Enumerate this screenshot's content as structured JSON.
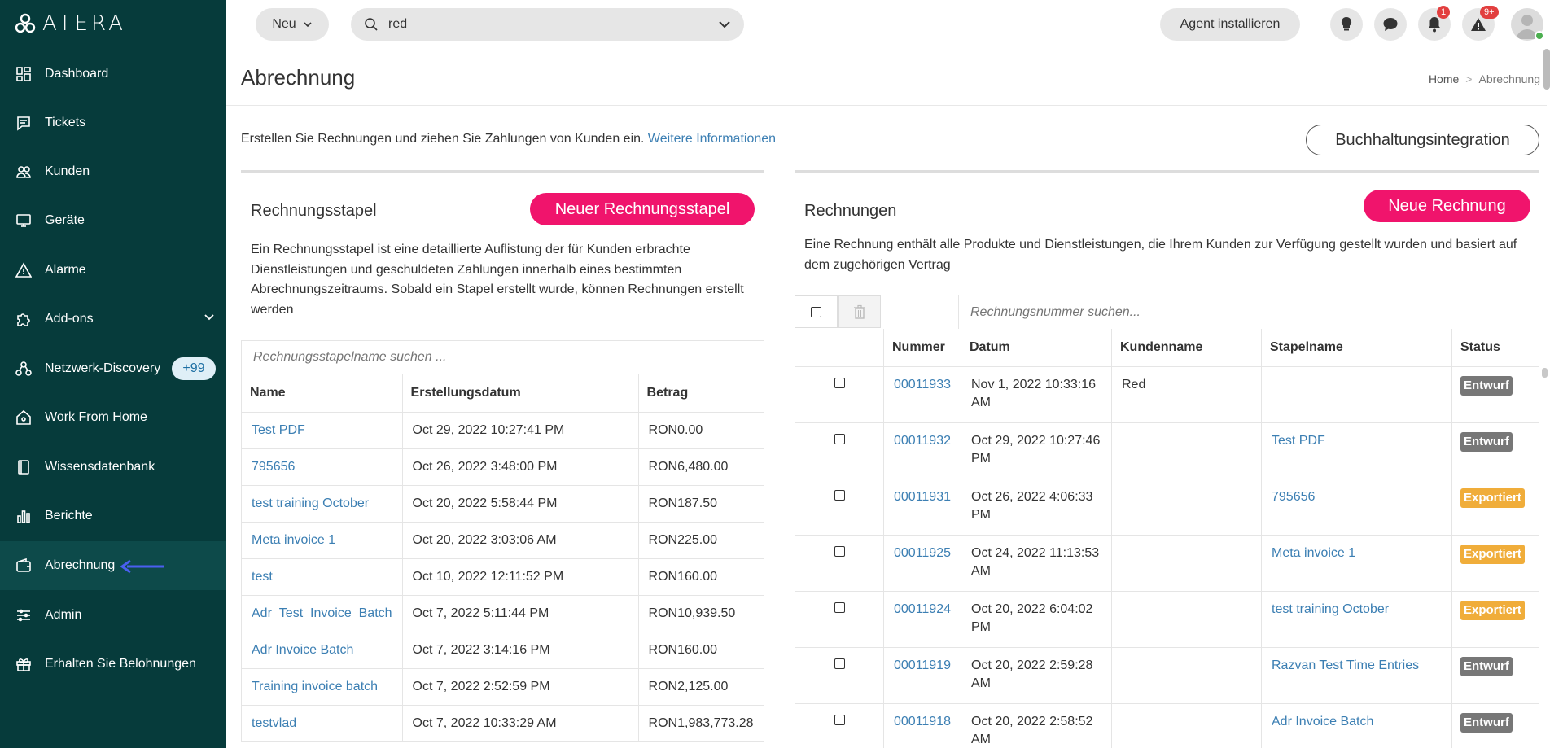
{
  "app": {
    "logo_text": "ATERA"
  },
  "sidebar": {
    "items": [
      {
        "label": "Dashboard",
        "icon": "dashboard-icon"
      },
      {
        "label": "Tickets",
        "icon": "tickets-icon"
      },
      {
        "label": "Kunden",
        "icon": "users-icon"
      },
      {
        "label": "Geräte",
        "icon": "monitor-icon"
      },
      {
        "label": "Alarme",
        "icon": "warning-icon"
      },
      {
        "label": "Add-ons",
        "icon": "puzzle-icon"
      },
      {
        "label": "Netzwerk-Discovery",
        "icon": "network-icon",
        "badge": "+99"
      },
      {
        "label": "Work From Home",
        "icon": "home-icon"
      },
      {
        "label": "Wissensdatenbank",
        "icon": "book-icon"
      },
      {
        "label": "Berichte",
        "icon": "chart-icon"
      },
      {
        "label": "Abrechnung",
        "icon": "wallet-icon"
      },
      {
        "label": "Admin",
        "icon": "sliders-icon"
      },
      {
        "label": "Erhalten Sie Belohnungen",
        "icon": "gift-icon"
      }
    ]
  },
  "topbar": {
    "new_label": "Neu",
    "search_value": "red",
    "agent_label": "Agent installieren",
    "notif_count": "1",
    "alert_count": "9+"
  },
  "header": {
    "title": "Abrechnung",
    "breadcrumb_home": "Home",
    "breadcrumb_sep": ">",
    "breadcrumb_current": "Abrechnung"
  },
  "intro": {
    "text": "Erstellen Sie Rechnungen und ziehen Sie Zahlungen von Kunden ein.",
    "link": "Weitere Informationen",
    "accounting_button": "Buchhaltungsintegration"
  },
  "batches": {
    "title": "Rechnungsstapel",
    "new_button": "Neuer Rechnungsstapel",
    "description": "Ein Rechnungsstapel ist eine detaillierte Auflistung der für Kunden erbrachte Dienstleistungen und geschuldeten Zahlungen innerhalb eines bestimmten Abrechnungszeitraums. Sobald ein Stapel erstellt wurde, können Rechnungen erstellt werden",
    "search_placeholder": "Rechnungsstapelname suchen ...",
    "columns": [
      "Name",
      "Erstellungsdatum",
      "Betrag"
    ],
    "rows": [
      {
        "name": "Test PDF",
        "date": "Oct 29, 2022 10:27:41 PM",
        "amount": "RON0.00"
      },
      {
        "name": "795656",
        "date": "Oct 26, 2022 3:48:00 PM",
        "amount": "RON6,480.00"
      },
      {
        "name": "test training October",
        "date": "Oct 20, 2022 5:58:44 PM",
        "amount": "RON187.50"
      },
      {
        "name": "Meta invoice 1",
        "date": "Oct 20, 2022 3:03:06 AM",
        "amount": "RON225.00"
      },
      {
        "name": "test",
        "date": "Oct 10, 2022 12:11:52 PM",
        "amount": "RON160.00"
      },
      {
        "name": "Adr_Test_Invoice_Batch",
        "date": "Oct 7, 2022 5:11:44 PM",
        "amount": "RON10,939.50"
      },
      {
        "name": "Adr Invoice Batch",
        "date": "Oct 7, 2022 3:14:16 PM",
        "amount": "RON160.00"
      },
      {
        "name": "Training invoice batch",
        "date": "Oct 7, 2022 2:52:59 PM",
        "amount": "RON2,125.00"
      },
      {
        "name": "testvlad",
        "date": "Oct 7, 2022 10:33:29 AM",
        "amount": "RON1,983,773.28"
      }
    ]
  },
  "invoices": {
    "title": "Rechnungen",
    "new_button": "Neue Rechnung",
    "description": "Eine Rechnung enthält alle Produkte und Dienstleistungen, die Ihrem Kunden zur Verfügung gestellt wurden und basiert auf dem zugehörigen Vertrag",
    "search_placeholder": "Rechnungsnummer suchen...",
    "columns": [
      "Nummer",
      "Datum",
      "Kundenname",
      "Stapelname",
      "Status"
    ],
    "rows": [
      {
        "number": "00011933",
        "date": "Nov 1, 2022 10:33:16 AM",
        "customer": "Red",
        "batch": "",
        "status": "Entwurf"
      },
      {
        "number": "00011932",
        "date": "Oct 29, 2022 10:27:46 PM",
        "customer": "",
        "batch": "Test PDF",
        "status": "Entwurf"
      },
      {
        "number": "00011931",
        "date": "Oct 26, 2022 4:06:33 PM",
        "customer": "",
        "batch": "795656",
        "status": "Exportiert"
      },
      {
        "number": "00011925",
        "date": "Oct 24, 2022 11:13:53 AM",
        "customer": "",
        "batch": "Meta invoice 1",
        "status": "Exportiert"
      },
      {
        "number": "00011924",
        "date": "Oct 20, 2022 6:04:02 PM",
        "customer": "",
        "batch": "test training October",
        "status": "Exportiert"
      },
      {
        "number": "00011919",
        "date": "Oct 20, 2022 2:59:28 AM",
        "customer": "",
        "batch": "Razvan Test Time Entries",
        "status": "Entwurf"
      },
      {
        "number": "00011918",
        "date": "Oct 20, 2022 2:58:52 AM",
        "customer": "",
        "batch": "Adr Invoice Batch",
        "status": "Entwurf"
      }
    ]
  },
  "colors": {
    "sidebar_bg": "#063b3b",
    "accent_pink": "#f0146c",
    "link_blue": "#3c7fb3",
    "status_draft": "#777777",
    "status_exported": "#f0ad3a",
    "active_arrow": "#4a5ff0"
  }
}
